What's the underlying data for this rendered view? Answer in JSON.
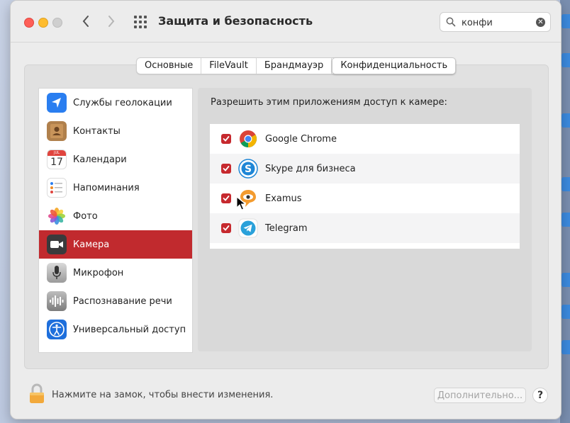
{
  "window": {
    "title": "Защита и безопасность"
  },
  "search": {
    "value": "конфи"
  },
  "tabs": [
    {
      "label": "Основные"
    },
    {
      "label": "FileVault"
    },
    {
      "label": "Брандмауэр"
    },
    {
      "label": "Конфиденциальность",
      "selected": true
    }
  ],
  "sidebar": {
    "items": [
      {
        "label": "Службы геолокации",
        "icon": "location-arrow-icon"
      },
      {
        "label": "Контакты",
        "icon": "contacts-icon"
      },
      {
        "label": "Календари",
        "icon": "calendar-icon",
        "icon_month": "JUL",
        "icon_day": "17"
      },
      {
        "label": "Напоминания",
        "icon": "reminders-icon"
      },
      {
        "label": "Фото",
        "icon": "photos-icon"
      },
      {
        "label": "Камера",
        "icon": "camera-icon",
        "selected": true
      },
      {
        "label": "Микрофон",
        "icon": "microphone-icon"
      },
      {
        "label": "Распознавание речи",
        "icon": "speech-recognition-icon"
      },
      {
        "label": "Универсальный доступ",
        "icon": "accessibility-icon"
      }
    ]
  },
  "main": {
    "heading": "Разрешить этим приложениям доступ к камере:",
    "apps": [
      {
        "name": "Google Chrome",
        "checked": true,
        "icon": "chrome-icon"
      },
      {
        "name": "Skype для бизнеса",
        "checked": true,
        "icon": "skype-icon"
      },
      {
        "name": "Examus",
        "checked": true,
        "icon": "examus-icon"
      },
      {
        "name": "Telegram",
        "checked": true,
        "icon": "telegram-icon"
      }
    ]
  },
  "footer": {
    "lock_text": "Нажмите на замок, чтобы внести изменения.",
    "advanced_button": "Дополнительно...",
    "help_button": "?"
  },
  "colors": {
    "accent": "#c12a2e",
    "checkbox": "#c6292e"
  }
}
